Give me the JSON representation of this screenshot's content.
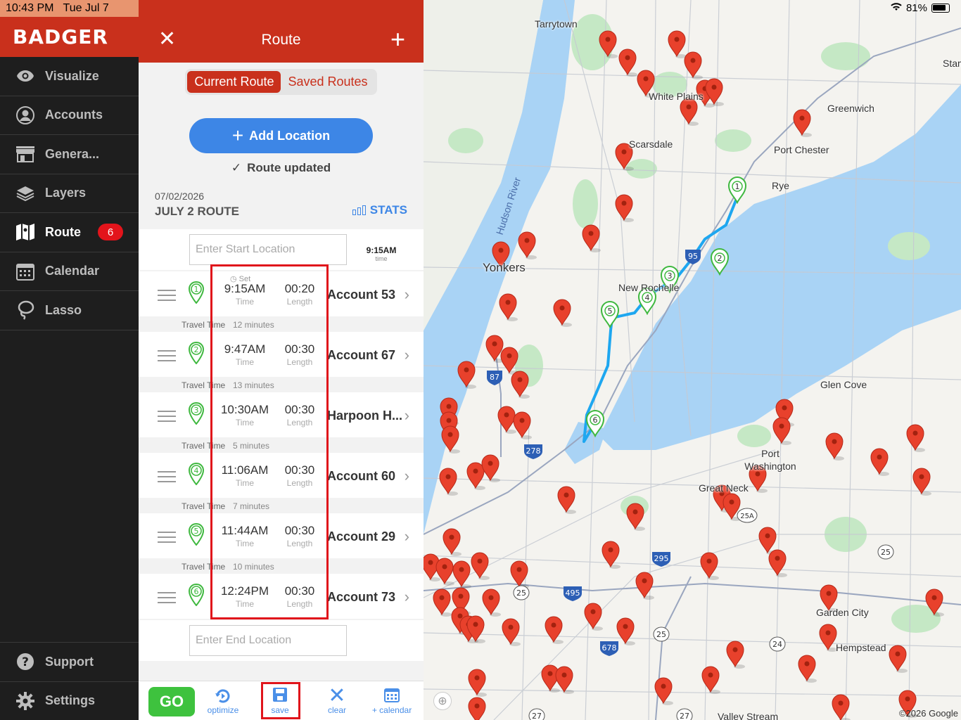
{
  "status": {
    "time": "10:43 PM",
    "date": "Tue Jul 7",
    "battery": "81%"
  },
  "sidebar": {
    "logo": "BADGER",
    "items": [
      {
        "label": "Visualize",
        "icon": "eye-icon"
      },
      {
        "label": "Accounts",
        "icon": "user-circle-icon"
      },
      {
        "label": "Genera...",
        "icon": "storefront-icon"
      },
      {
        "label": "Layers",
        "icon": "layers-icon"
      },
      {
        "label": "Route",
        "icon": "map-icon",
        "badge": "6",
        "active": true
      },
      {
        "label": "Calendar",
        "icon": "calendar-icon"
      },
      {
        "label": "Lasso",
        "icon": "lasso-icon"
      }
    ],
    "bottom": [
      {
        "label": "Support",
        "icon": "help-icon"
      },
      {
        "label": "Settings",
        "icon": "gear-icon"
      }
    ]
  },
  "panel": {
    "title": "Route",
    "tabs": {
      "current": "Current Route",
      "saved": "Saved Routes"
    },
    "add_location": "Add Location",
    "route_updated": "Route updated",
    "route_date": "07/02/2026",
    "route_name": "JULY 2 ROUTE",
    "stats": "STATS",
    "start_placeholder": "Enter Start Location",
    "start_time": "9:15AM",
    "start_time_label": "time",
    "end_placeholder": "Enter End Location",
    "time_label": "Time",
    "length_label": "Length",
    "set_label": "Set",
    "travel_label": "Travel Time",
    "stops": [
      {
        "num": "1",
        "time": "9:15AM",
        "length": "00:20",
        "name": "Account 53",
        "travel": "12 minutes"
      },
      {
        "num": "2",
        "time": "9:47AM",
        "length": "00:30",
        "name": "Account 67",
        "travel": "13 minutes"
      },
      {
        "num": "3",
        "time": "10:30AM",
        "length": "00:30",
        "name": "Harpoon H...",
        "travel": "5 minutes"
      },
      {
        "num": "4",
        "time": "11:06AM",
        "length": "00:30",
        "name": "Account 60",
        "travel": "7 minutes"
      },
      {
        "num": "5",
        "time": "11:44AM",
        "length": "00:30",
        "name": "Account 29",
        "travel": "10 minutes"
      },
      {
        "num": "6",
        "time": "12:24PM",
        "length": "00:30",
        "name": "Account 73"
      }
    ],
    "toolbar": {
      "go": "GO",
      "optimize": "optimize",
      "save": "save",
      "clear": "clear",
      "calendar": "+ calendar"
    }
  },
  "map": {
    "labels": [
      "Tarrytown",
      "White Plains",
      "Greenwich",
      "Scarsdale",
      "Port Chester",
      "Rye",
      "Hudson River",
      "Yonkers",
      "New Rochelle",
      "Glen Cove",
      "Port Washington",
      "Great Neck",
      "Garden City",
      "Hempstead",
      "Valley Stream",
      "Stamford"
    ],
    "route_markers": [
      "1",
      "2",
      "3",
      "4",
      "5",
      "6"
    ],
    "shields": [
      "95",
      "87",
      "278",
      "295",
      "495",
      "678",
      "25",
      "25A",
      "24",
      "27"
    ],
    "copyright": "©2026 Google",
    "colors": {
      "route": "#1ea7f0",
      "pin": "#e8412c",
      "route_pin": "#3fb83f"
    }
  }
}
